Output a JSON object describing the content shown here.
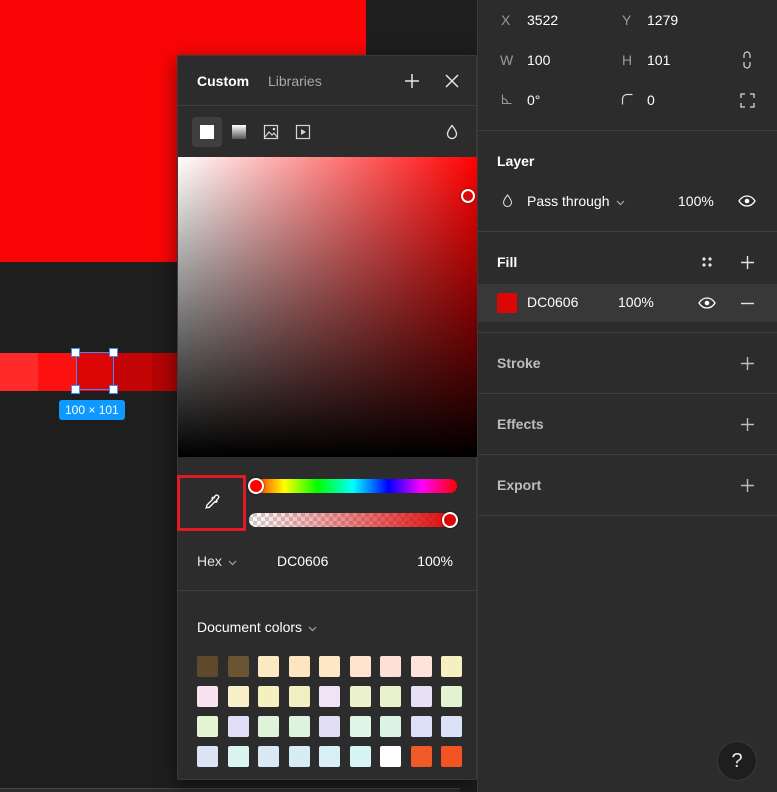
{
  "canvas": {
    "frame_color": "#fa0505",
    "selection_size": "100 × 101",
    "strip_colors": [
      "#ff2a2a",
      "#fd1010",
      "#f00606",
      "#dc0606",
      "#c40505"
    ]
  },
  "picker": {
    "tabs": [
      "Custom",
      "Libraries"
    ],
    "header_icons": [
      "plus-icon",
      "close-icon"
    ],
    "fill_types": [
      "solid-fill-icon",
      "gradient-fill-icon",
      "image-fill-icon",
      "video-fill-icon"
    ],
    "blend_icon": "drop-icon",
    "eyedropper_icon": "eyedropper-icon",
    "hue_color": "#ff0000",
    "current_color": "#dc0606",
    "format_label": "Hex",
    "hex_value": "DC0606",
    "opacity": "100%",
    "document_colors_label": "Document colors",
    "document_colors": [
      "#5e4a2b",
      "#6a5433",
      "#fbe9c2",
      "#fde6bf",
      "#fde7c5",
      "#ffe3cf",
      "#ffe0d6",
      "#fde3dc",
      "#f6efc0",
      "#f9e1f0",
      "#f8eec7",
      "#f4f0c0",
      "#f1f0c2",
      "#f0e3f5",
      "#ecf3cc",
      "#e8f3cd",
      "#e8e1f5",
      "#e3f3d2",
      "#e5f4d5",
      "#e0ddf5",
      "#dff2da",
      "#def3dd",
      "#e1ddf5",
      "#dff5e6",
      "#daf3e4",
      "#dcdff5",
      "#dce2f5",
      "#dbe4f5",
      "#daf5ef",
      "#d8e8f5",
      "#d8ecf5",
      "#d8f0f5",
      "#d8f5f5",
      "#ffffff",
      "#f05a28",
      "#f45422"
    ]
  },
  "panel": {
    "x_label": "X",
    "x_value": "3522",
    "y_label": "Y",
    "y_value": "1279",
    "w_label": "W",
    "w_value": "100",
    "h_label": "H",
    "h_value": "101",
    "rotation_value": "0°",
    "radius_value": "0",
    "layer_title": "Layer",
    "blend_mode": "Pass through",
    "layer_opacity": "100%",
    "fill_title": "Fill",
    "fill_color": "#dc0606",
    "fill_hex": "DC0606",
    "fill_opacity": "100%",
    "stroke_title": "Stroke",
    "effects_title": "Effects",
    "export_title": "Export",
    "help_label": "?"
  }
}
